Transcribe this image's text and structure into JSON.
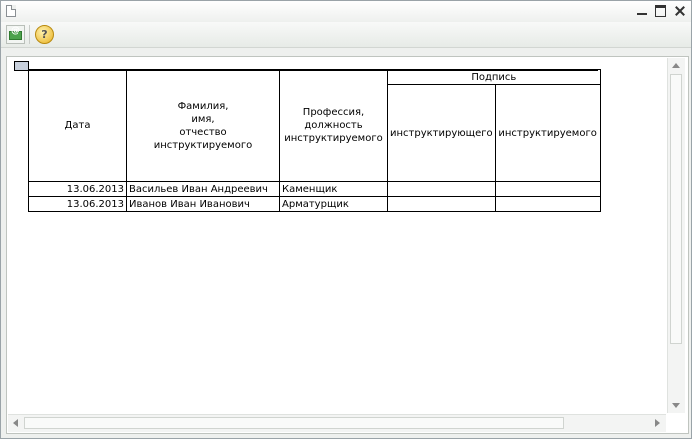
{
  "window": {
    "icons": {
      "app": "document-icon",
      "minimize": "minimize-icon",
      "maximize": "maximize-icon",
      "close": "close-icon"
    }
  },
  "toolbar": {
    "buttons": [
      {
        "icon": "email-send-icon",
        "glyph": "@"
      },
      {
        "icon": "help-icon",
        "glyph": "?"
      }
    ]
  },
  "table": {
    "headers": {
      "date": "Дата",
      "name_line1": "Фамилия,",
      "name_line2": "имя,",
      "name_line3": "отчество",
      "name_line4": "инструктируемого",
      "profession_line1": "Профессия,",
      "profession_line2": "должность",
      "profession_line3": "инструктируемого",
      "signature": "Подпись",
      "signature_instructor": "инструктирующего",
      "signature_instructed": "инструктируемого"
    },
    "rows": [
      {
        "date": "13.06.2013",
        "name": "Васильев Иван Андреевич",
        "profession": "Каменщик",
        "sign_instructor": "",
        "sign_instructed": ""
      },
      {
        "date": "13.06.2013",
        "name": "Иванов Иван Иванович",
        "profession": "Арматурщик",
        "sign_instructor": "",
        "sign_instructed": ""
      }
    ]
  }
}
